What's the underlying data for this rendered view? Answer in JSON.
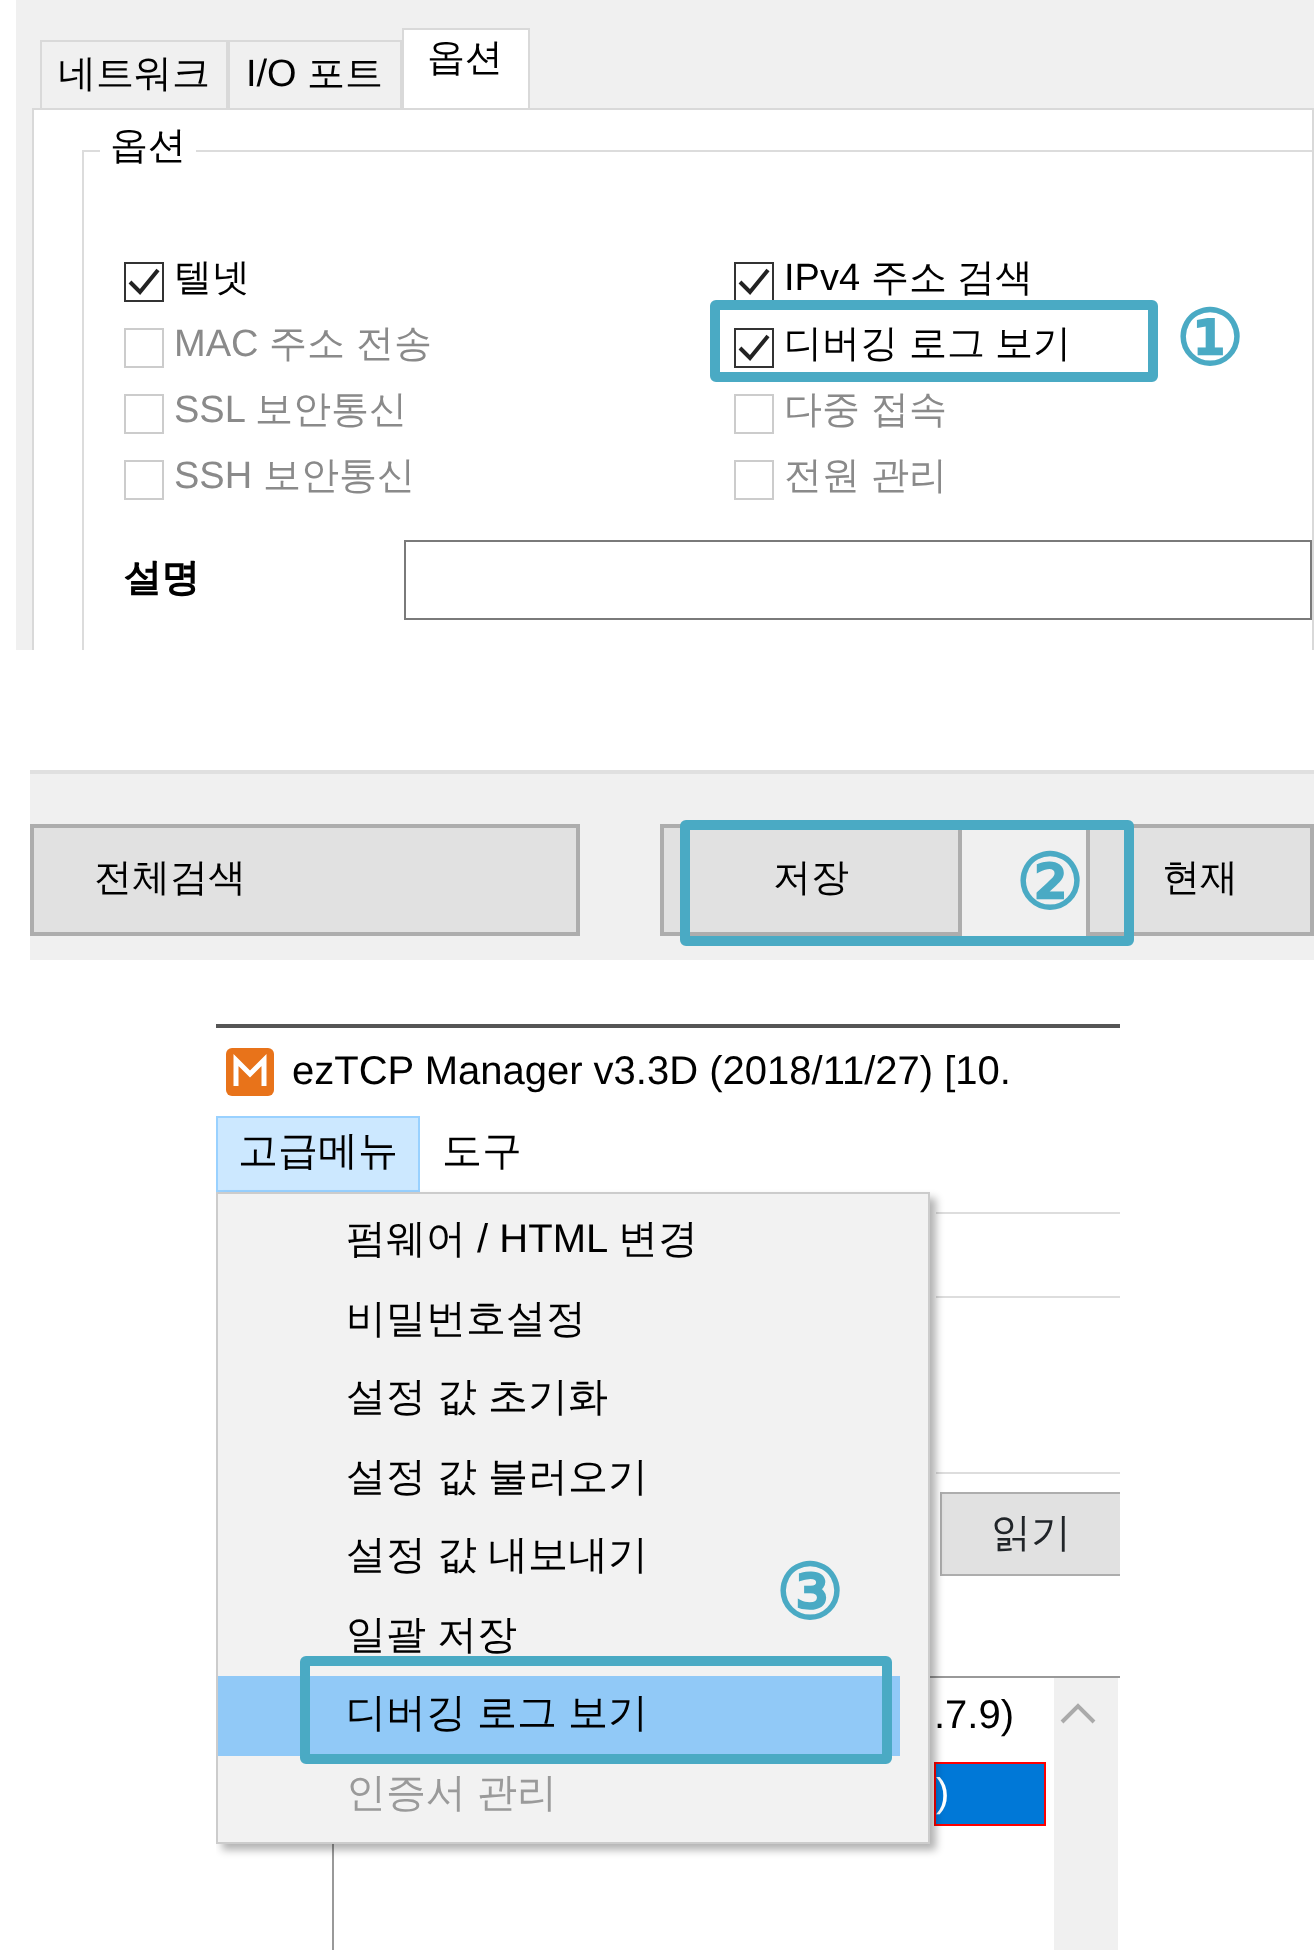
{
  "options_panel": {
    "tabs": [
      {
        "label": "네트워크",
        "selected": false
      },
      {
        "label": "I/O 포트",
        "selected": false
      },
      {
        "label": "옵션",
        "selected": true
      }
    ],
    "group_title": "옵션",
    "checkboxes": [
      {
        "label": "텔넷",
        "checked": true,
        "disabled": false
      },
      {
        "label": "IPv4 주소 검색",
        "checked": true,
        "disabled": false
      },
      {
        "label": "MAC 주소 전송",
        "checked": false,
        "disabled": true
      },
      {
        "label": "디버깅 로그 보기",
        "checked": true,
        "disabled": false
      },
      {
        "label": "SSL 보안통신",
        "checked": false,
        "disabled": true
      },
      {
        "label": "다중 접속",
        "checked": false,
        "disabled": true
      },
      {
        "label": "SSH 보안통신",
        "checked": false,
        "disabled": true
      },
      {
        "label": "전원 관리",
        "checked": false,
        "disabled": true
      }
    ],
    "description_label": "설명",
    "annotation": {
      "label": "①"
    }
  },
  "button_panel": {
    "buttons": [
      "전체검색",
      "저장",
      "현재"
    ],
    "annotation": {
      "label": "②"
    }
  },
  "menu_panel": {
    "window": {
      "title": "ezTCP Manager v3.3D (2018/11/27) [10."
    },
    "menubar": [
      {
        "label": "고급메뉴",
        "selected": true
      },
      {
        "label": "도구",
        "selected": false
      }
    ],
    "menu_items": [
      {
        "label": "펌웨어 / HTML 변경",
        "selected": false,
        "disabled": false
      },
      {
        "label": "비밀번호설정",
        "selected": false,
        "disabled": false
      },
      {
        "label": "설정 값 초기화",
        "selected": false,
        "disabled": false
      },
      {
        "label": "설정 값 불러오기",
        "selected": false,
        "disabled": false
      },
      {
        "label": "설정 값 내보내기",
        "selected": false,
        "disabled": false
      },
      {
        "label": "일괄 저장",
        "selected": false,
        "disabled": false
      },
      {
        "label": "디버깅 로그 보기",
        "selected": true,
        "disabled": false
      },
      {
        "label": "인증서 관리",
        "selected": false,
        "disabled": true
      }
    ],
    "read_button": "읽기",
    "list_rows": [
      {
        "text": ".7.9)",
        "selected": false
      },
      {
        "text": ")",
        "selected": true
      }
    ],
    "annotation": {
      "label": "③"
    }
  }
}
